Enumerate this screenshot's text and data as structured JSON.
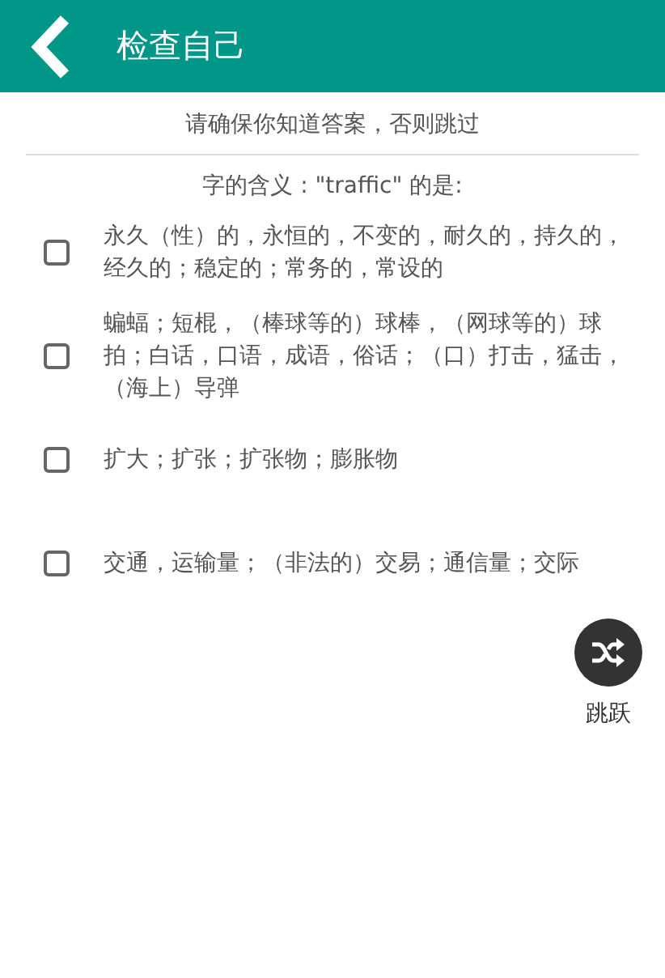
{
  "app_bar": {
    "title": "检查自己"
  },
  "notice": "请确保你知道答案，否则跳过",
  "question": "字的含义 : \"traffic\" 的是:",
  "options": [
    {
      "text": "永久（性）的，永恒的，不变的，耐久的，持久的，经久的；稳定的；常务的，常设的",
      "checked": false
    },
    {
      "text": "蝙蝠；短棍，（棒球等的）球棒，（网球等的）球拍；白话，口语，成语，俗话；（口）打击，猛击，（海上）导弹",
      "checked": false
    },
    {
      "text": "扩大；扩张；扩张物；膨胀物",
      "checked": false
    },
    {
      "text": "交通，运输量；（非法的）交易；通信量；交际",
      "checked": false
    }
  ],
  "skip_button": {
    "label": "跳跃"
  }
}
